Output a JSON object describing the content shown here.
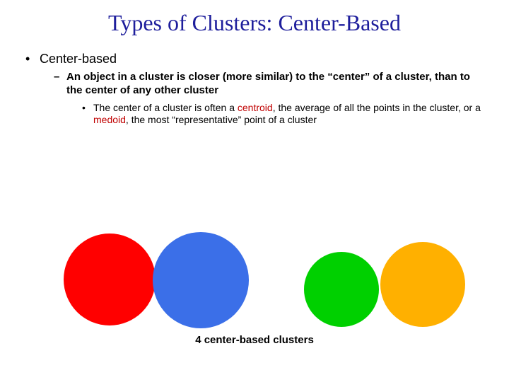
{
  "title": "Types of Clusters: Center-Based",
  "bullet1": "Center-based",
  "bullet2": "An object in a cluster is closer (more similar) to the “center” of a cluster, than to the center of any other cluster",
  "bullet3_pre": "The center of a cluster is often a ",
  "bullet3_kw1": "centroid",
  "bullet3_mid": ", the average of all the points in the cluster, or a ",
  "bullet3_kw2": "medoid",
  "bullet3_post": ", the most “representative” point of a cluster",
  "caption": "4 center-based clusters",
  "clusters": {
    "red": {
      "color": "#ff0000"
    },
    "blue": {
      "color": "#3b6fe8"
    },
    "green": {
      "color": "#00d000"
    },
    "orange": {
      "color": "#ffb000"
    }
  }
}
